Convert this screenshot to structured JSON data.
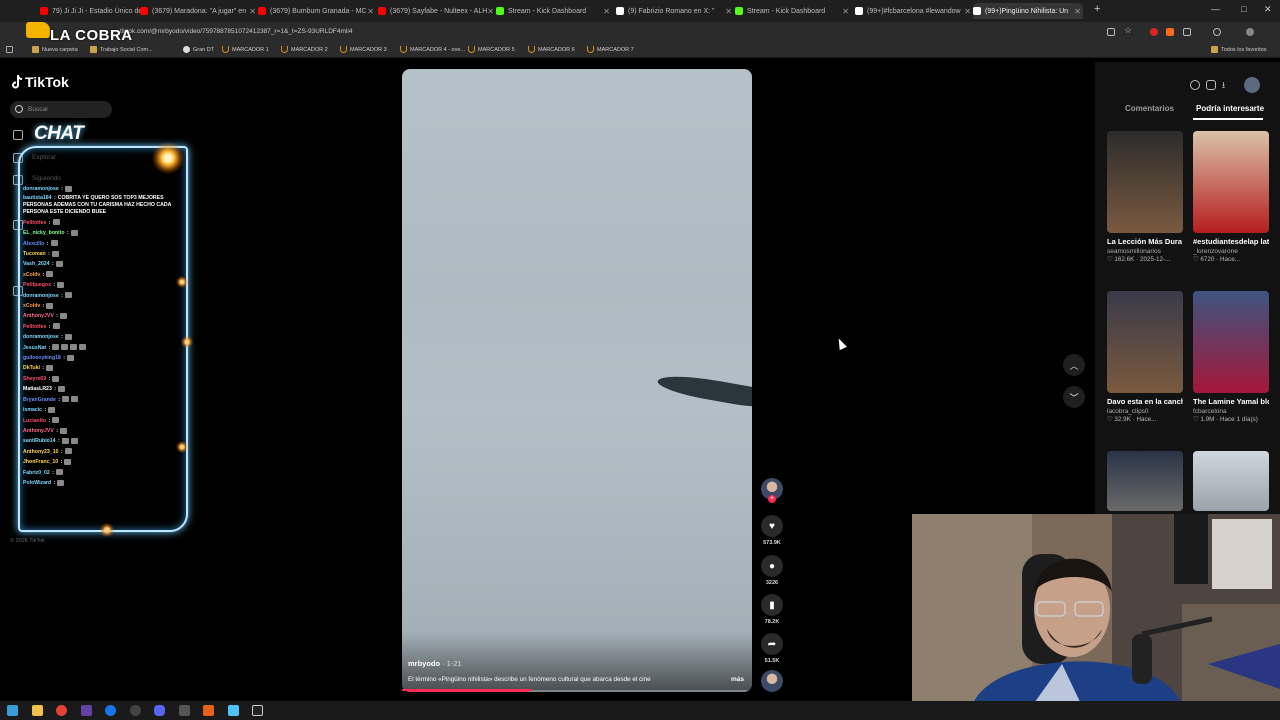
{
  "browser": {
    "tabs": [
      {
        "label": "79) Ji Ji Ji - Estadio Único de",
        "favicon_color": "#ff0000"
      },
      {
        "label": "(3679) Maradona: \"A jugar\" en",
        "favicon_color": "#ff0000"
      },
      {
        "label": "(3679) Bumbum Granada - MC",
        "favicon_color": "#ff0000"
      },
      {
        "label": "(3679) Sayfabe - Nulteex - ALH",
        "favicon_color": "#ff0000"
      },
      {
        "label": "Stream - Kick Dashboard",
        "favicon_color": "#53fc18"
      },
      {
        "label": "(9) Fabrizio Romano en X: \"",
        "favicon_color": "#ffffff"
      },
      {
        "label": "Stream - Kick Dashboard",
        "favicon_color": "#53fc18"
      },
      {
        "label": "(99+)#fcbarcelona #lewandow",
        "favicon_color": "#ffffff"
      },
      {
        "label": "(99+)Pingüino Nihilista: Un",
        "favicon_color": "#ffffff"
      }
    ],
    "new_tab_label": "+",
    "url": "tiktok.com/@mrbyodo/video/7597887851072412387_r=1&_t=ZS-93URLDF4mli4",
    "overlay_brand": "LA COBRA",
    "bookmarks": [
      {
        "label": "Nueva carpeta",
        "kind": "folder"
      },
      {
        "label": "Trabajo Social Com...",
        "kind": "folder"
      },
      {
        "label": "Gran DT",
        "kind": "site"
      },
      {
        "label": "MARCADOR 1",
        "kind": "magnet"
      },
      {
        "label": "MARCADOR 2",
        "kind": "magnet"
      },
      {
        "label": "MARCADOR 3",
        "kind": "magnet"
      },
      {
        "label": "MARCADOR 4 - ove...",
        "kind": "magnet"
      },
      {
        "label": "MARCADOR 5",
        "kind": "magnet"
      },
      {
        "label": "MARCADOR 6",
        "kind": "magnet"
      },
      {
        "label": "MARCADOR 7",
        "kind": "magnet"
      }
    ],
    "all_favorites": "Todos los favoritos"
  },
  "tiktok": {
    "logo": "TikTok",
    "search_placeholder": "Buscar",
    "nav_explorar": "Explorar",
    "nav_siguiendo": "Siguiendo",
    "copyright": "© 2026 TikTok"
  },
  "chat": {
    "title": "CHAT",
    "lines": [
      {
        "user": "donramonjose",
        "color": "#7fd6ff",
        "emotes": 1
      },
      {
        "user": "bautista184",
        "color": "#7fd6ff",
        "multiline": "COBRITA YE QUERO SOS TOP3 MEJORES PERSONAS ADEMAS CON TU CARISMA HAZ HECHO CADA PERSONA ESTE DICIENDO BUEE"
      },
      {
        "user": "Pelitotfee",
        "color": "#ff4f6d",
        "emotes": 1
      },
      {
        "user": "EL_nicky_bonito",
        "color": "#7dff8a",
        "emotes": 1
      },
      {
        "user": "Alexcillo",
        "color": "#6b8cff",
        "emotes": 1
      },
      {
        "user": "Tucoman",
        "color": "#ffd84a",
        "emotes": 1
      },
      {
        "user": "Vash_2024",
        "color": "#7fd6ff",
        "emotes": 1
      },
      {
        "user": "xColdv",
        "color": "#ff9f43",
        "emotes": 1
      },
      {
        "user": "Petitjuegos",
        "color": "#ff4f6d",
        "emotes": 1
      },
      {
        "user": "donramonjose",
        "color": "#7fd6ff",
        "emotes": 1
      },
      {
        "user": "xColdv",
        "color": "#ff9f43",
        "emotes": 1
      },
      {
        "user": "AnthonyJVV",
        "color": "#ff6b8a",
        "emotes": 1
      },
      {
        "user": "Pelitotfee",
        "color": "#ff4f6d",
        "emotes": 1
      },
      {
        "user": "donramonjose",
        "color": "#7fd6ff",
        "emotes": 1
      },
      {
        "user": "JesusNat",
        "color": "#7fd6ff",
        "emotes": 4
      },
      {
        "user": "guilosoyking18",
        "color": "#6b8cff",
        "emotes": 1
      },
      {
        "user": "DkTuki",
        "color": "#ffd84a",
        "emotes": 1
      },
      {
        "user": "Sheyre69",
        "color": "#ff4f6d",
        "emotes": 1
      },
      {
        "user": "MatiasLR23",
        "color": "#ffffff",
        "emotes": 1
      },
      {
        "user": "BryanGrande",
        "color": "#6b8cff",
        "emotes": 2
      },
      {
        "user": "ismacic",
        "color": "#7fd6ff",
        "emotes": 1
      },
      {
        "user": "Lucianito",
        "color": "#ff4f6d",
        "emotes": 1
      },
      {
        "user": "AnthonyJVV",
        "color": "#ff6b8a",
        "emotes": 1
      },
      {
        "user": "santiRubio14",
        "color": "#7fd6ff",
        "emotes": 2
      },
      {
        "user": "Anthony23_10",
        "color": "#ffd84a",
        "emotes": 1
      },
      {
        "user": "JhonFranc_10",
        "color": "#ffd84a",
        "emotes": 1
      },
      {
        "user": "Fabriz0_02",
        "color": "#7fd6ff",
        "emotes": 1
      },
      {
        "user": "PoloWizard",
        "color": "#7fd6ff",
        "emotes": 1
      }
    ]
  },
  "video": {
    "author": "mrbyodo",
    "date": "· 1-21",
    "caption": "El término «Pingüino nihilista» describe un fenómeno cultural que abarca desde el cine",
    "more": "más",
    "progress_fraction": 0.36
  },
  "actions": {
    "likes": "573.9K",
    "comments": "3226",
    "saves": "78.2K",
    "shares": "51.5K"
  },
  "right_panel": {
    "tab_comments": "Comentarios",
    "tab_interest": "Podría interesarte",
    "cards": [
      {
        "title": "La Lección Más Dura Que...",
        "author": "seamosmillonarios",
        "stats": "♡ 162.6K · 2025-12-...",
        "thumb_top": "#2c2c2c",
        "thumb_bottom": "#7a5a40"
      },
      {
        "title": "#estudiantesdelap lata #bocajunior...",
        "author": "_lorenzovarone",
        "stats": "♡ 6720 · Hace...",
        "thumb_top": "#d9c2a8",
        "thumb_bottom": "#b51e1e"
      },
      {
        "title": "Davo esta en la cancha . . ....",
        "author": "lacobra_clips0",
        "stats": "♡ 32.9K · Hace...",
        "thumb_top": "#3a3a4a",
        "thumb_bottom": "#7a5a3e"
      },
      {
        "title": "The Lamine Yamal bloopers you...",
        "author": "fcbarcelona",
        "stats": "♡ 1.9M · Hace 1 día(s)",
        "thumb_top": "#3d5580",
        "thumb_bottom": "#a5173a"
      },
      {
        "title": "",
        "author": "",
        "stats": "",
        "thumb_top": "#2a3446",
        "thumb_bottom": "#6a6a6a"
      },
      {
        "title": "",
        "author": "",
        "stats": "",
        "thumb_top": "#cfd6dd",
        "thumb_bottom": "#9aa3ab"
      }
    ]
  }
}
